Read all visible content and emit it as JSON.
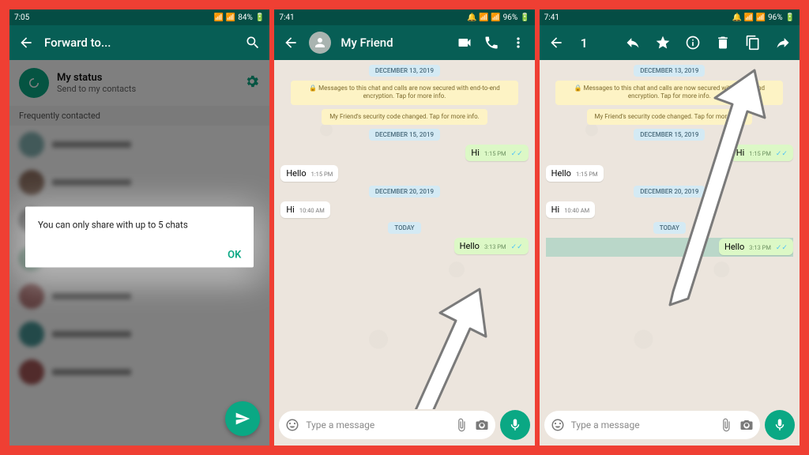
{
  "panel1": {
    "status_time": "7:05",
    "status_right": "84%",
    "title": "Forward to...",
    "my_status_label": "My status",
    "my_status_sub": "Send to my contacts",
    "freq_label": "Frequently contacted",
    "dialog_text": "You can only share with up to 5 chats",
    "ok_label": "OK"
  },
  "panel2": {
    "status_time": "7:41",
    "status_right": "96%",
    "contact_name": "My Friend",
    "date1": "DECEMBER 13, 2019",
    "enc_text": "🔒 Messages to this chat and calls are now secured with end-to-end encryption. Tap for more info.",
    "sec_code_text": "My Friend's security code changed. Tap for more info.",
    "date2": "DECEMBER 15, 2019",
    "msg_hi": "Hi",
    "msg_hi_time": "1:15 PM",
    "msg_hello": "Hello",
    "msg_hello_time": "1:15 PM",
    "date3": "DECEMBER 20, 2019",
    "msg_hi2": "Hi",
    "msg_hi2_time": "10:40 AM",
    "date_today": "TODAY",
    "msg_hello2": "Hello",
    "msg_hello2_time": "3:13 PM",
    "input_placeholder": "Type a message"
  },
  "panel3": {
    "status_time": "7:41",
    "status_right": "96%",
    "selected_count": "1",
    "date1": "DECEMBER 13, 2019",
    "enc_text": "🔒 Messages to this chat and calls are now secured with end-to-end encryption. Tap for more info.",
    "sec_code_text": "My Friend's security code changed. Tap for more info.",
    "date2": "DECEMBER 15, 2019",
    "msg_hi": "Hi",
    "msg_hi_time": "1:15 PM",
    "msg_hello": "Hello",
    "msg_hello_time": "1:15 PM",
    "date3": "DECEMBER 20, 2019",
    "msg_hi2": "Hi",
    "msg_hi2_time": "10:40 AM",
    "date_today": "TODAY",
    "msg_hello2": "Hello",
    "msg_hello2_time": "3:13 PM",
    "input_placeholder": "Type a message"
  }
}
